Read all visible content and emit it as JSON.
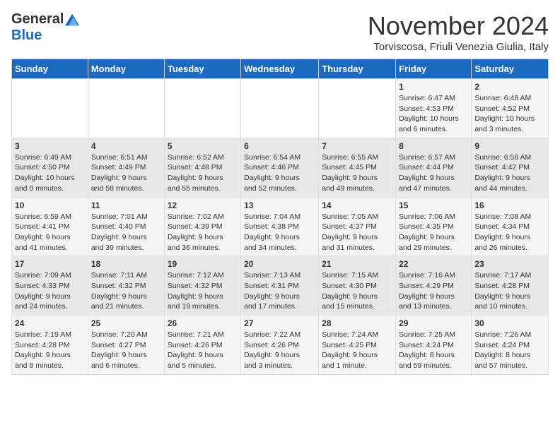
{
  "logo": {
    "general": "General",
    "blue": "Blue"
  },
  "title": "November 2024",
  "subtitle": "Torviscosa, Friuli Venezia Giulia, Italy",
  "headers": [
    "Sunday",
    "Monday",
    "Tuesday",
    "Wednesday",
    "Thursday",
    "Friday",
    "Saturday"
  ],
  "weeks": [
    [
      {
        "day": "",
        "info": ""
      },
      {
        "day": "",
        "info": ""
      },
      {
        "day": "",
        "info": ""
      },
      {
        "day": "",
        "info": ""
      },
      {
        "day": "",
        "info": ""
      },
      {
        "day": "1",
        "info": "Sunrise: 6:47 AM\nSunset: 4:53 PM\nDaylight: 10 hours\nand 6 minutes."
      },
      {
        "day": "2",
        "info": "Sunrise: 6:48 AM\nSunset: 4:52 PM\nDaylight: 10 hours\nand 3 minutes."
      }
    ],
    [
      {
        "day": "3",
        "info": "Sunrise: 6:49 AM\nSunset: 4:50 PM\nDaylight: 10 hours\nand 0 minutes."
      },
      {
        "day": "4",
        "info": "Sunrise: 6:51 AM\nSunset: 4:49 PM\nDaylight: 9 hours\nand 58 minutes."
      },
      {
        "day": "5",
        "info": "Sunrise: 6:52 AM\nSunset: 4:48 PM\nDaylight: 9 hours\nand 55 minutes."
      },
      {
        "day": "6",
        "info": "Sunrise: 6:54 AM\nSunset: 4:46 PM\nDaylight: 9 hours\nand 52 minutes."
      },
      {
        "day": "7",
        "info": "Sunrise: 6:55 AM\nSunset: 4:45 PM\nDaylight: 9 hours\nand 49 minutes."
      },
      {
        "day": "8",
        "info": "Sunrise: 6:57 AM\nSunset: 4:44 PM\nDaylight: 9 hours\nand 47 minutes."
      },
      {
        "day": "9",
        "info": "Sunrise: 6:58 AM\nSunset: 4:42 PM\nDaylight: 9 hours\nand 44 minutes."
      }
    ],
    [
      {
        "day": "10",
        "info": "Sunrise: 6:59 AM\nSunset: 4:41 PM\nDaylight: 9 hours\nand 41 minutes."
      },
      {
        "day": "11",
        "info": "Sunrise: 7:01 AM\nSunset: 4:40 PM\nDaylight: 9 hours\nand 39 minutes."
      },
      {
        "day": "12",
        "info": "Sunrise: 7:02 AM\nSunset: 4:39 PM\nDaylight: 9 hours\nand 36 minutes."
      },
      {
        "day": "13",
        "info": "Sunrise: 7:04 AM\nSunset: 4:38 PM\nDaylight: 9 hours\nand 34 minutes."
      },
      {
        "day": "14",
        "info": "Sunrise: 7:05 AM\nSunset: 4:37 PM\nDaylight: 9 hours\nand 31 minutes."
      },
      {
        "day": "15",
        "info": "Sunrise: 7:06 AM\nSunset: 4:35 PM\nDaylight: 9 hours\nand 29 minutes."
      },
      {
        "day": "16",
        "info": "Sunrise: 7:08 AM\nSunset: 4:34 PM\nDaylight: 9 hours\nand 26 minutes."
      }
    ],
    [
      {
        "day": "17",
        "info": "Sunrise: 7:09 AM\nSunset: 4:33 PM\nDaylight: 9 hours\nand 24 minutes."
      },
      {
        "day": "18",
        "info": "Sunrise: 7:11 AM\nSunset: 4:32 PM\nDaylight: 9 hours\nand 21 minutes."
      },
      {
        "day": "19",
        "info": "Sunrise: 7:12 AM\nSunset: 4:32 PM\nDaylight: 9 hours\nand 19 minutes."
      },
      {
        "day": "20",
        "info": "Sunrise: 7:13 AM\nSunset: 4:31 PM\nDaylight: 9 hours\nand 17 minutes."
      },
      {
        "day": "21",
        "info": "Sunrise: 7:15 AM\nSunset: 4:30 PM\nDaylight: 9 hours\nand 15 minutes."
      },
      {
        "day": "22",
        "info": "Sunrise: 7:16 AM\nSunset: 4:29 PM\nDaylight: 9 hours\nand 13 minutes."
      },
      {
        "day": "23",
        "info": "Sunrise: 7:17 AM\nSunset: 4:28 PM\nDaylight: 9 hours\nand 10 minutes."
      }
    ],
    [
      {
        "day": "24",
        "info": "Sunrise: 7:19 AM\nSunset: 4:28 PM\nDaylight: 9 hours\nand 8 minutes."
      },
      {
        "day": "25",
        "info": "Sunrise: 7:20 AM\nSunset: 4:27 PM\nDaylight: 9 hours\nand 6 minutes."
      },
      {
        "day": "26",
        "info": "Sunrise: 7:21 AM\nSunset: 4:26 PM\nDaylight: 9 hours\nand 5 minutes."
      },
      {
        "day": "27",
        "info": "Sunrise: 7:22 AM\nSunset: 4:26 PM\nDaylight: 9 hours\nand 3 minutes."
      },
      {
        "day": "28",
        "info": "Sunrise: 7:24 AM\nSunset: 4:25 PM\nDaylight: 9 hours\nand 1 minute."
      },
      {
        "day": "29",
        "info": "Sunrise: 7:25 AM\nSunset: 4:24 PM\nDaylight: 8 hours\nand 59 minutes."
      },
      {
        "day": "30",
        "info": "Sunrise: 7:26 AM\nSunset: 4:24 PM\nDaylight: 8 hours\nand 57 minutes."
      }
    ]
  ]
}
